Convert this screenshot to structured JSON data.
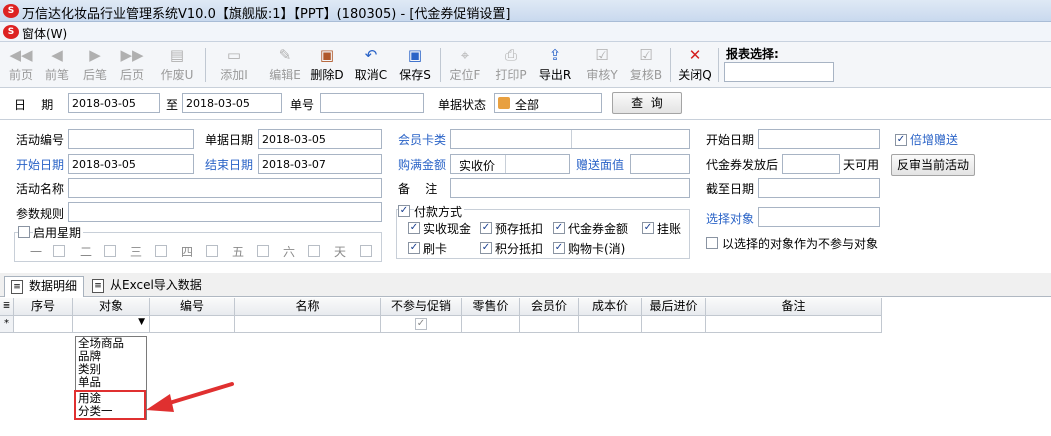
{
  "window": {
    "title": "万信达化妆品行业管理系统V10.0【旗舰版:1】【PPT】(180305) - [代金券促销设置]"
  },
  "menu": {
    "window_label": "窗体(W)"
  },
  "toolbar": {
    "buttons": [
      {
        "label": "前页",
        "icon": "first-page-icon"
      },
      {
        "label": "前笔",
        "icon": "prev-record-icon"
      },
      {
        "label": "后笔",
        "icon": "next-record-icon"
      },
      {
        "label": "后页",
        "icon": "last-page-icon"
      },
      {
        "label": "作废U",
        "icon": "void-icon"
      },
      {
        "label": "添加I",
        "icon": "add-icon"
      },
      {
        "label": "编辑E",
        "icon": "edit-icon"
      },
      {
        "label": "删除D",
        "icon": "delete-icon"
      },
      {
        "label": "取消C",
        "icon": "undo-icon"
      },
      {
        "label": "保存S",
        "icon": "save-icon"
      },
      {
        "label": "定位F",
        "icon": "locate-icon"
      },
      {
        "label": "打印P",
        "icon": "print-icon"
      },
      {
        "label": "导出R",
        "icon": "export-icon"
      },
      {
        "label": "审核Y",
        "icon": "approve-icon"
      },
      {
        "label": "复核B",
        "icon": "review-icon"
      },
      {
        "label": "关闭Q",
        "icon": "close-icon"
      }
    ],
    "report_select_label": "报表选择:",
    "report_select_value": ""
  },
  "search": {
    "date_label": "日    期",
    "date_from": "2018-03-05",
    "to_label": "至",
    "date_to": "2018-03-05",
    "doc_no_label": "单号",
    "doc_no_value": "",
    "status_label": "单据状态",
    "status_value": "全部",
    "query_button": "查  询"
  },
  "form": {
    "activity_no_label": "活动编号",
    "activity_no_value": "",
    "doc_date_label": "单据日期",
    "doc_date_value": "2018-03-05",
    "member_card_label": "会员卡类",
    "member_card_value": "",
    "start_date_right_label": "开始日期",
    "start_date_right_value": "",
    "double_gift_label": "倍增赠送",
    "start_date_label": "开始日期",
    "start_date_value": "2018-03-05",
    "end_date_label": "结束日期",
    "end_date_value": "2018-03-07",
    "full_amount_label": "购满金额",
    "full_amount_basis": "实收价",
    "gift_value_label": "赠送面值",
    "gift_value_value": "",
    "voucher_after_label": "代金券发放后",
    "voucher_after_value": "",
    "days_usable_label": "天可用",
    "reverse_button": "反审当前活动",
    "activity_name_label": "活动名称",
    "activity_name_value": "",
    "remark_label": "备    注",
    "remark_value": "",
    "deadline_label": "截至日期",
    "deadline_value": "",
    "param_rule_label": "参数规则",
    "param_rule_value": "",
    "payment_label": "付款方式",
    "payments": [
      {
        "label": "实收现金",
        "checked": true
      },
      {
        "label": "预存抵扣",
        "checked": true
      },
      {
        "label": "代金券金额",
        "checked": true
      },
      {
        "label": "挂账",
        "checked": true
      },
      {
        "label": "刷卡",
        "checked": true
      },
      {
        "label": "积分抵扣",
        "checked": true
      },
      {
        "label": "购物卡(消)",
        "checked": true
      }
    ],
    "select_target_label": "选择对象",
    "select_target_value": "",
    "exclude_selected_label": "以选择的对象作为不参与对象",
    "enable_weekday_label": "启用星期",
    "weekdays": [
      "一",
      "二",
      "三",
      "四",
      "五",
      "六",
      "天"
    ]
  },
  "tabs": [
    {
      "label": "数据明细",
      "active": true
    },
    {
      "label": "从Excel导入数据",
      "active": false
    }
  ],
  "grid": {
    "columns": [
      "序号",
      "对象",
      "编号",
      "名称",
      "不参与促销",
      "零售价",
      "会员价",
      "成本价",
      "最后进价",
      "备注"
    ],
    "new_row_marker": "*",
    "dropdown_options": [
      "全场商品",
      "品牌",
      "类别",
      "单品",
      "用途",
      "分类一"
    ],
    "highlighted_options": [
      "用途",
      "分类一"
    ]
  },
  "colors": {
    "accent_blue": "#2a63c7",
    "highlight_red": "#e03030"
  }
}
